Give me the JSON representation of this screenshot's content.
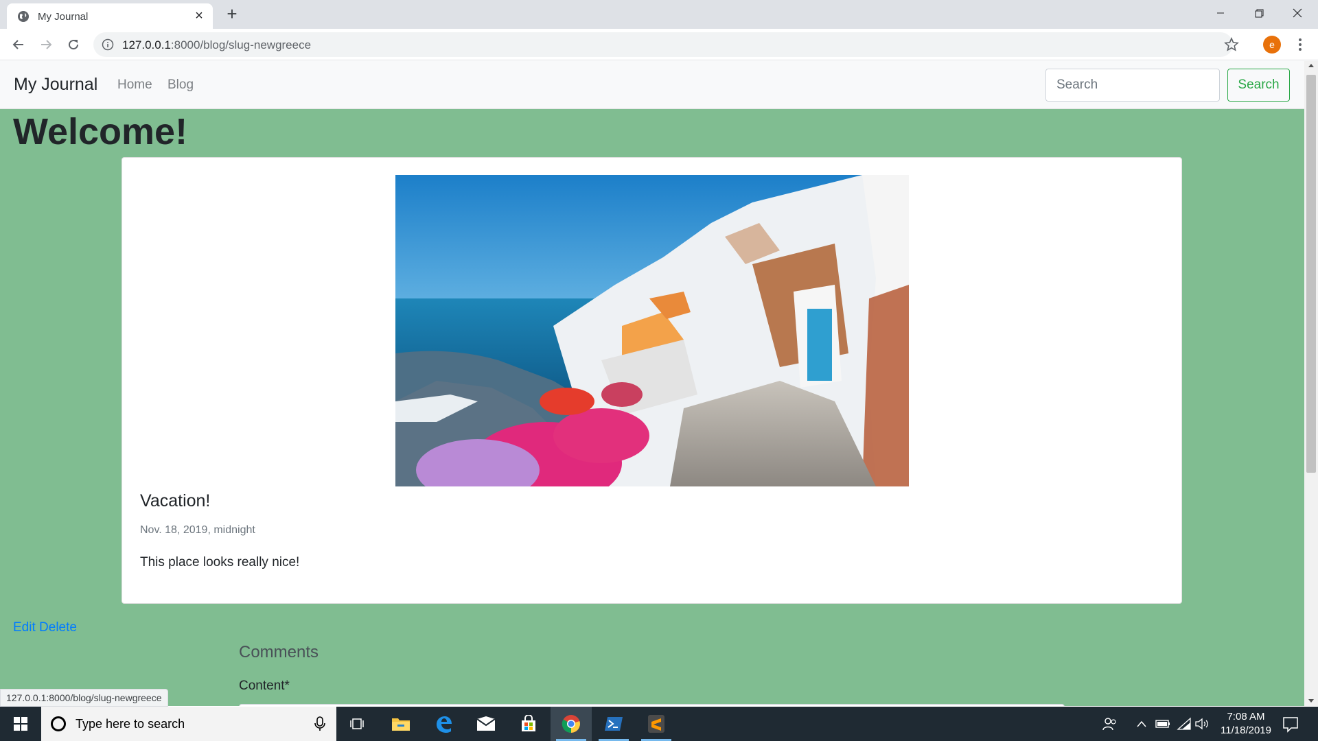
{
  "browser": {
    "tab_title": "My Journal",
    "url_host": "127.0.0.1",
    "url_path": ":8000/blog/slug-newgreece",
    "profile_initial": "e",
    "status_url": "127.0.0.1:8000/blog/slug-newgreece"
  },
  "site": {
    "brand": "My Journal",
    "nav": [
      {
        "label": "Home"
      },
      {
        "label": "Blog"
      }
    ],
    "search": {
      "placeholder": "Search",
      "button_label": "Search"
    }
  },
  "page": {
    "heading": "Welcome!",
    "post": {
      "title": "Vacation!",
      "date": "Nov. 18, 2019, midnight",
      "body": "This place looks really nice!"
    },
    "actions": {
      "edit_label": "Edit",
      "delete_label": "Delete"
    },
    "comments": {
      "heading": "Comments",
      "content_label": "Content*"
    }
  },
  "taskbar": {
    "search_placeholder": "Type here to search",
    "time": "7:08 AM",
    "date": "11/18/2019",
    "apps": [
      "task-view",
      "file-explorer",
      "edge",
      "mail",
      "store",
      "chrome",
      "powershell",
      "sublime-text"
    ]
  },
  "colors": {
    "page_background": "#80bd91",
    "link": "#007bff",
    "search_button": "#28a745"
  }
}
